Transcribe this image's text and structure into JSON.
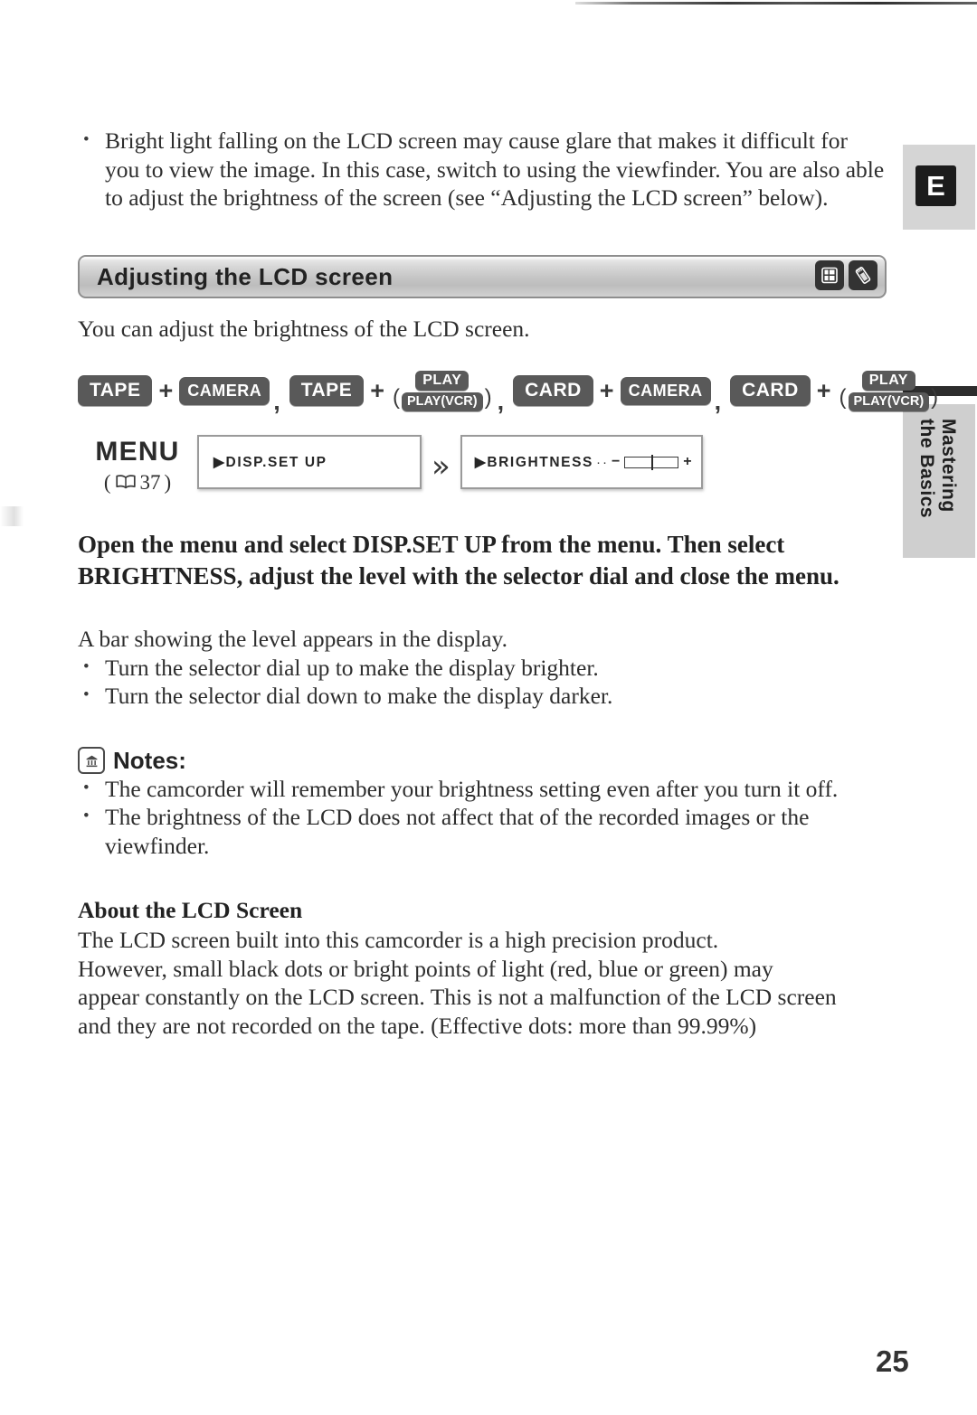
{
  "page": {
    "number": "25",
    "language_tab": "E"
  },
  "sidebar": {
    "vertical_line1": "Mastering",
    "vertical_line2": "the Basics"
  },
  "intro": {
    "bullet": "Bright light falling on the LCD screen may cause glare that makes it difficult for you to view the image. In this case, switch to using the viewfinder. You are also able to adjust the brightness of the screen (see “Adjusting the LCD screen” below)."
  },
  "section": {
    "title": "Adjusting the LCD screen",
    "icons": [
      "tape-cassette-icon",
      "memory-card-icon"
    ],
    "lead": "You can adjust the brightness of the LCD screen."
  },
  "mode_row": {
    "groups": [
      {
        "primary": "TAPE",
        "plus": "+",
        "secondary": "CAMERA",
        "separator": ","
      },
      {
        "primary": "TAPE",
        "plus": "+",
        "secondary_top": "PLAY",
        "secondary_bottom": "PLAY(VCR)",
        "paren_open": "(",
        "paren_close": ")",
        "separator": ","
      },
      {
        "primary": "CARD",
        "plus": "+",
        "secondary": "CAMERA",
        "separator": ","
      },
      {
        "primary": "CARD",
        "plus": "+",
        "secondary_top": "PLAY",
        "secondary_bottom": "PLAY(VCR)",
        "paren_open": "(",
        "paren_close": ")",
        "separator": ""
      }
    ]
  },
  "menu_row": {
    "menu_word": "MENU",
    "page_ref_open": "(",
    "page_ref_number": "37",
    "page_ref_close": ")",
    "lcd_first": "▶DISP.SET UP",
    "chevron": "»",
    "lcd_second_label": "▶BRIGHTNESS",
    "lcd_second_dots": "··",
    "lcd_minus": "−",
    "lcd_plus": "+"
  },
  "instruction": "Open the menu and select DISP.SET UP from the menu. Then select BRIGHTNESS, adjust the level with the selector dial and close the menu.",
  "after_bar": {
    "lead": "A bar showing the level appears in the display.",
    "bullets": [
      "Turn the selector dial up to make the display brighter.",
      "Turn the selector dial down to make the display darker."
    ]
  },
  "notes": {
    "icon": "memo-note-icon",
    "heading": "Notes:",
    "bullets": [
      "The camcorder will remember your brightness setting even after you turn it off.",
      "The brightness of the LCD does not affect that of the recorded images or the viewfinder."
    ]
  },
  "about": {
    "heading": "About the LCD Screen",
    "lines": [
      "The LCD screen built into this camcorder is a high precision product.",
      "However, small black dots or bright points of light (red, blue or green) may",
      "appear constantly on the LCD screen. This is not a malfunction of the LCD screen",
      "and they are not recorded on the tape. (Effective dots: more than 99.99%)"
    ]
  },
  "colors": {
    "ink": "#2e2e2e",
    "badge": "#595959",
    "bar_dark": "#333333",
    "tab_gray": "#d5d5d5"
  }
}
